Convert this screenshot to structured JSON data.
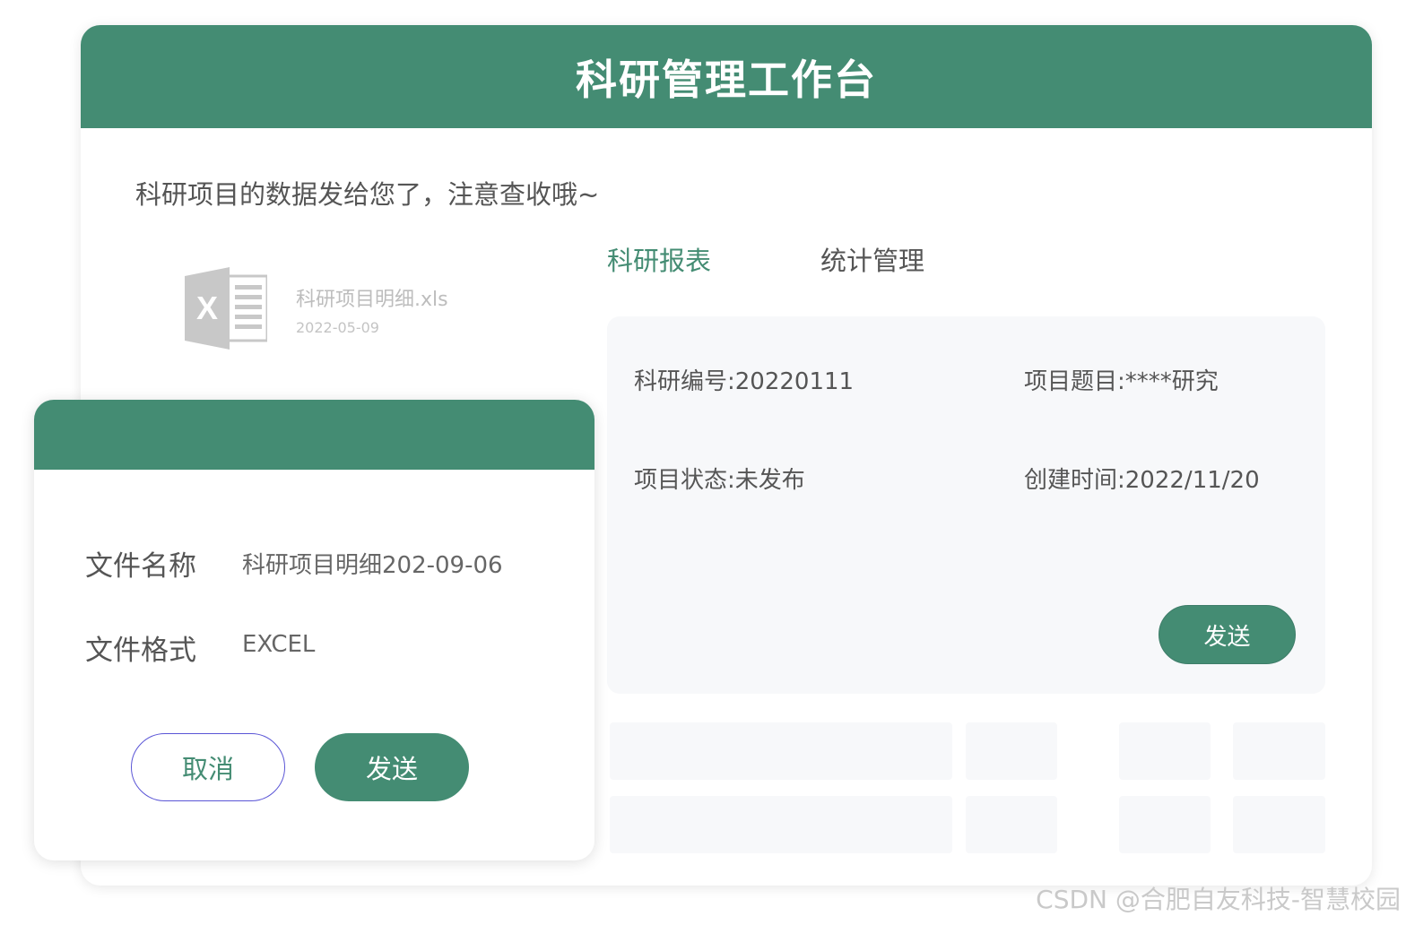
{
  "colors": {
    "brand_green": "#448c73",
    "panel_bg": "#f7f8fa",
    "text_dark": "#555555",
    "file_icon_gray": "#c8c8c8",
    "cancel_border": "#5a55d6"
  },
  "workbench": {
    "title": "科研管理工作台",
    "message": "科研项目的数据发给您了，注意查收哦~"
  },
  "attachment": {
    "icon": "excel-file-icon",
    "icon_letter": "X",
    "file_name": "科研项目明细.xls",
    "date": "2022-05-09"
  },
  "tabs": [
    {
      "label": "科研报表",
      "active": true
    },
    {
      "label": "统计管理",
      "active": false
    }
  ],
  "info_panel": {
    "research_id": "科研编号:20220111",
    "project_topic": "项目题目:****研究",
    "project_status": "项目状态:未发布",
    "created_time": "创建时间:2022/11/20",
    "send_label": "发送"
  },
  "dialog": {
    "file_name_label": "文件名称",
    "file_name_value": "科研项目明细202-09-06",
    "file_format_label": "文件格式",
    "file_format_value": "EXCEL",
    "cancel_label": "取消",
    "send_label": "发送"
  },
  "watermark": "CSDN @合肥自友科技-智慧校园"
}
